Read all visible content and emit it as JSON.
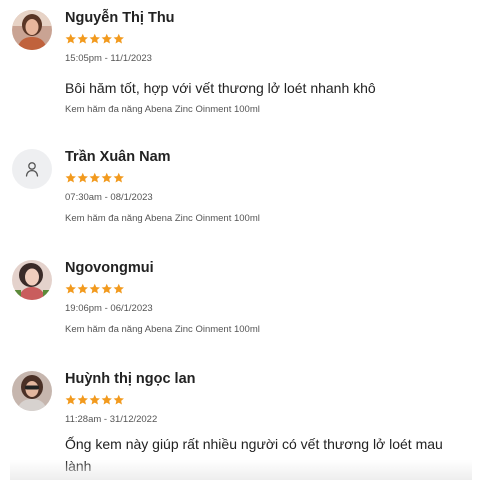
{
  "reviews": [
    {
      "author": "Nguyễn Thị Thu",
      "rating": 5,
      "timestamp": "15:05pm - 11/1/2023",
      "comment": "Bôi hăm tốt, hợp với vết thương lở loét nhanh khô",
      "product": "Kem hăm đa năng Abena Zinc Oinment 100ml",
      "avatar": "user-photo"
    },
    {
      "author": "Trần Xuân Nam",
      "rating": 5,
      "timestamp": "07:30am - 08/1/2023",
      "comment": "",
      "product": "Kem hăm đa năng Abena Zinc Oinment 100ml",
      "avatar": "user-icon"
    },
    {
      "author": "Ngovongmui",
      "rating": 5,
      "timestamp": "19:06pm - 06/1/2023",
      "comment": "",
      "product": "Kem hăm đa năng Abena Zinc Oinment 100ml",
      "avatar": "user-photo"
    },
    {
      "author": "Huỳnh thị ngọc lan",
      "rating": 5,
      "timestamp": "11:28am - 31/12/2022",
      "comment": "Ống kem này giúp rất nhiều người có vết thương lở loét mau lành",
      "product": "",
      "avatar": "user-photo"
    }
  ],
  "colors": {
    "star": "#f29a1e",
    "text": "#222222",
    "muted": "#555555"
  }
}
